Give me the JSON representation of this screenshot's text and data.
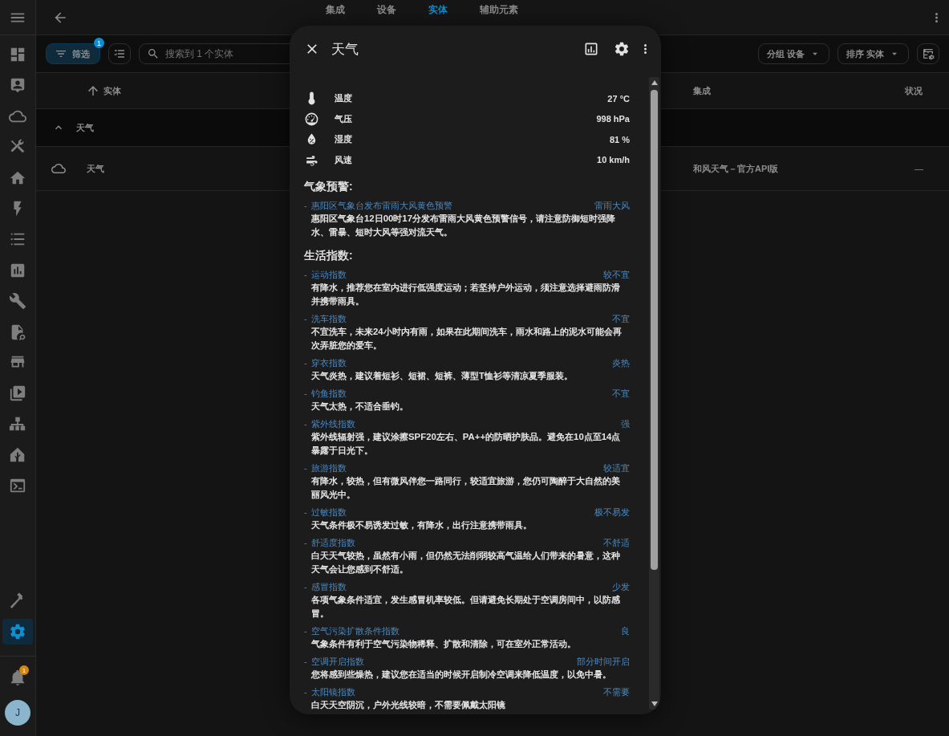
{
  "sidebar": {
    "items": [
      {
        "selected": false
      },
      {
        "selected": false
      },
      {
        "selected": false
      },
      {
        "selected": false
      },
      {
        "selected": false
      },
      {
        "selected": false
      },
      {
        "selected": false
      },
      {
        "selected": false
      },
      {
        "selected": false
      },
      {
        "selected": false
      },
      {
        "selected": false
      },
      {
        "selected": false
      },
      {
        "selected": false
      },
      {
        "selected": false
      },
      {
        "selected": false
      },
      {
        "selected": true
      }
    ],
    "notification_badge": "1",
    "avatar": "J"
  },
  "top_bar": {
    "tabs": [
      {
        "label": "集成",
        "selected": false
      },
      {
        "label": "设备",
        "selected": false
      },
      {
        "label": "实体",
        "selected": true
      },
      {
        "label": "辅助元素",
        "selected": false
      }
    ]
  },
  "toolbar": {
    "filter_button": {
      "label": "筛选",
      "badge": "1"
    },
    "search": {
      "placeholder": "搜索到 1 个实体"
    },
    "group_button": "分组 设备",
    "sort_button": "排序 实体"
  },
  "table": {
    "columns": [
      {
        "label": "实体",
        "sorted": true
      },
      {
        "label": "集成",
        "sorted": false
      },
      {
        "label": "状况",
        "sorted": false
      }
    ],
    "groups": [
      {
        "label": "天气",
        "expanded": true,
        "rows": [
          {
            "entity": "天气",
            "integration": "和风天气－官方API版",
            "status": "—"
          }
        ]
      }
    ]
  },
  "dialog": {
    "title": "天气",
    "attributes": [
      {
        "kind": "temperature",
        "label": "温度",
        "value": "27 °C"
      },
      {
        "kind": "pressure",
        "label": "气压",
        "value": "998 hPa"
      },
      {
        "kind": "humidity",
        "label": "湿度",
        "value": "81 %"
      },
      {
        "kind": "wind",
        "label": "风速",
        "value": "10 km/h"
      }
    ],
    "sections": [
      {
        "heading": "气象预警:",
        "items": [
          {
            "bullet": "-",
            "title": "惠阳区气象台发布雷雨大风黄色预警",
            "level": "雷雨大风",
            "text": "惠阳区气象台12日00时17分发布雷雨大风黄色预警信号，请注意防御短时强降水、雷暴、短时大风等强对流天气。"
          }
        ]
      },
      {
        "heading": "生活指数:",
        "items": [
          {
            "bullet": "-",
            "title": "运动指数",
            "level": "较不宜",
            "text": "有降水，推荐您在室内进行低强度运动；若坚持户外运动，须注意选择避雨防滑并携带雨具。"
          },
          {
            "bullet": "-",
            "title": "洗车指数",
            "level": "不宜",
            "text": "不宜洗车，未来24小时内有雨，如果在此期间洗车，雨水和路上的泥水可能会再次弄脏您的爱车。"
          },
          {
            "bullet": "-",
            "title": "穿衣指数",
            "level": "炎热",
            "text": "天气炎热，建议着短衫、短裙、短裤、薄型T恤衫等清凉夏季服装。"
          },
          {
            "bullet": "-",
            "title": "钓鱼指数",
            "level": "不宜",
            "text": "天气太热，不适合垂钓。"
          },
          {
            "bullet": "-",
            "title": "紫外线指数",
            "level": "强",
            "text": "紫外线辐射强，建议涂擦SPF20左右、PA++的防晒护肤品。避免在10点至14点暴露于日光下。"
          },
          {
            "bullet": "-",
            "title": "旅游指数",
            "level": "较适宜",
            "text": "有降水，较热，但有微风伴您一路同行，较适宜旅游，您仍可陶醉于大自然的美丽风光中。"
          },
          {
            "bullet": "-",
            "title": "过敏指数",
            "level": "极不易发",
            "text": "天气条件极不易诱发过敏，有降水，出行注意携带雨具。"
          },
          {
            "bullet": "-",
            "title": "舒适度指数",
            "level": "不舒适",
            "text": "白天天气较热，虽然有小雨，但仍然无法削弱较高气温给人们带来的暑意，这种天气会让您感到不舒适。"
          },
          {
            "bullet": "-",
            "title": "感冒指数",
            "level": "少发",
            "text": "各项气象条件适宜，发生感冒机率较低。但请避免长期处于空调房间中，以防感冒。"
          },
          {
            "bullet": "-",
            "title": "空气污染扩散条件指数",
            "level": "良",
            "text": "气象条件有利于空气污染物稀释、扩散和清除，可在室外正常活动。"
          },
          {
            "bullet": "-",
            "title": "空调开启指数",
            "level": "部分时间开启",
            "text": "您将感到些燥热，建议您在适当的时候开启制冷空调来降低温度，以免中暑。"
          },
          {
            "bullet": "-",
            "title": "太阳镜指数",
            "level": "不需要",
            "text": "白天天空阴沉，户外光线较暗，不需要佩戴太阳镜"
          }
        ]
      }
    ]
  }
}
